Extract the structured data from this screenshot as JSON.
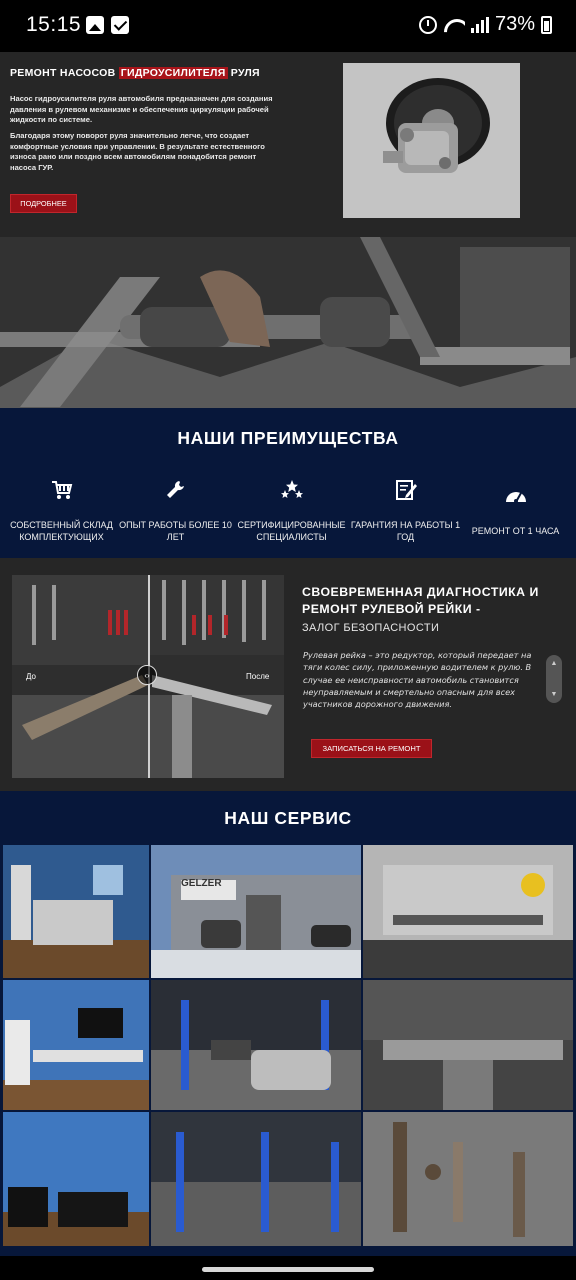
{
  "status_bar": {
    "time": "15:15",
    "icons": [
      "gallery-icon",
      "check-icon",
      "alarm-icon",
      "wifi-icon",
      "signal-icon",
      "battery-icon"
    ],
    "battery": "73%"
  },
  "pump_section": {
    "title_before": "РЕМОНТ НАСОСОВ ",
    "title_highlight": "ГИДРОУСИЛИТЕЛЯ",
    "title_after": " РУЛЯ",
    "paragraph1": "Насос гидроусилителя руля автомобиля предназначен для создания давления в рулевом механизме и обеспечения циркуляции рабочей жидкости по системе.",
    "paragraph2": "Благодаря этому поворот руля значительно легче, что создает комфортные условия при управлении. В результате естественного износа рано или поздно всем автомобилям понадобится ремонт насоса ГУР.",
    "more_button": "ПОДРОБНЕЕ"
  },
  "advantages": {
    "title": "НАШИ ПРЕИМУЩЕСТВА",
    "items": [
      {
        "icon": "cart-icon",
        "label": "СОБСТВЕННЫЙ СКЛАД КОМПЛЕКТУЮЩИХ"
      },
      {
        "icon": "wrench-icon",
        "label": "ОПЫТ РАБОТЫ БОЛЕЕ 10 ЛЕТ"
      },
      {
        "icon": "stars-icon",
        "label": "СЕРТИФИЦИРОВАННЫЕ СПЕЦИАЛИСТЫ"
      },
      {
        "icon": "document-edit-icon",
        "label": "ГАРАНТИЯ НА РАБОТЫ 1 ГОД"
      },
      {
        "icon": "speedometer-icon",
        "label": "РЕМОНТ ОТ 1 ЧАСА"
      }
    ]
  },
  "diagnostics": {
    "before_label": "До",
    "after_label": "После",
    "heading": "СВОЕВРЕМЕННАЯ ДИАГНОСТИКА И РЕМОНТ РУЛЕВОЙ РЕЙКИ -",
    "subheading": "ЗАЛОГ БЕЗОПАСНОСТИ",
    "text": "Рулевая рейка – это редуктор, который передает на тяги колес силу, приложенную водителем к рулю. В случае ее неисправности автомобиль становится неуправляемым и смертельно опасным для всех участников дорожного движения.",
    "signup_button": "ЗАПИСАТЬСЯ НА РЕМОНТ"
  },
  "service": {
    "title": "НАШ СЕРВИС",
    "sign_text": "GELZER"
  },
  "colors": {
    "accent_red": "#a8141a",
    "navy": "#07173a",
    "dark_bg": "#262626"
  }
}
